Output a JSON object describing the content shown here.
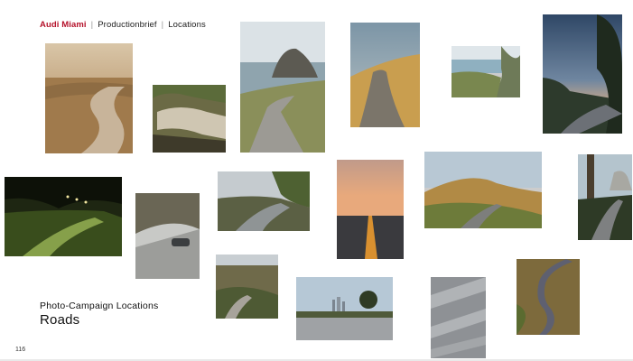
{
  "header": {
    "brand": "Audi Miami",
    "separator": "|",
    "section": "Productionbrief",
    "subsection": "Locations"
  },
  "caption": {
    "subtitle": "Photo-Campaign Locations",
    "title": "Roads"
  },
  "page_number": "116"
}
